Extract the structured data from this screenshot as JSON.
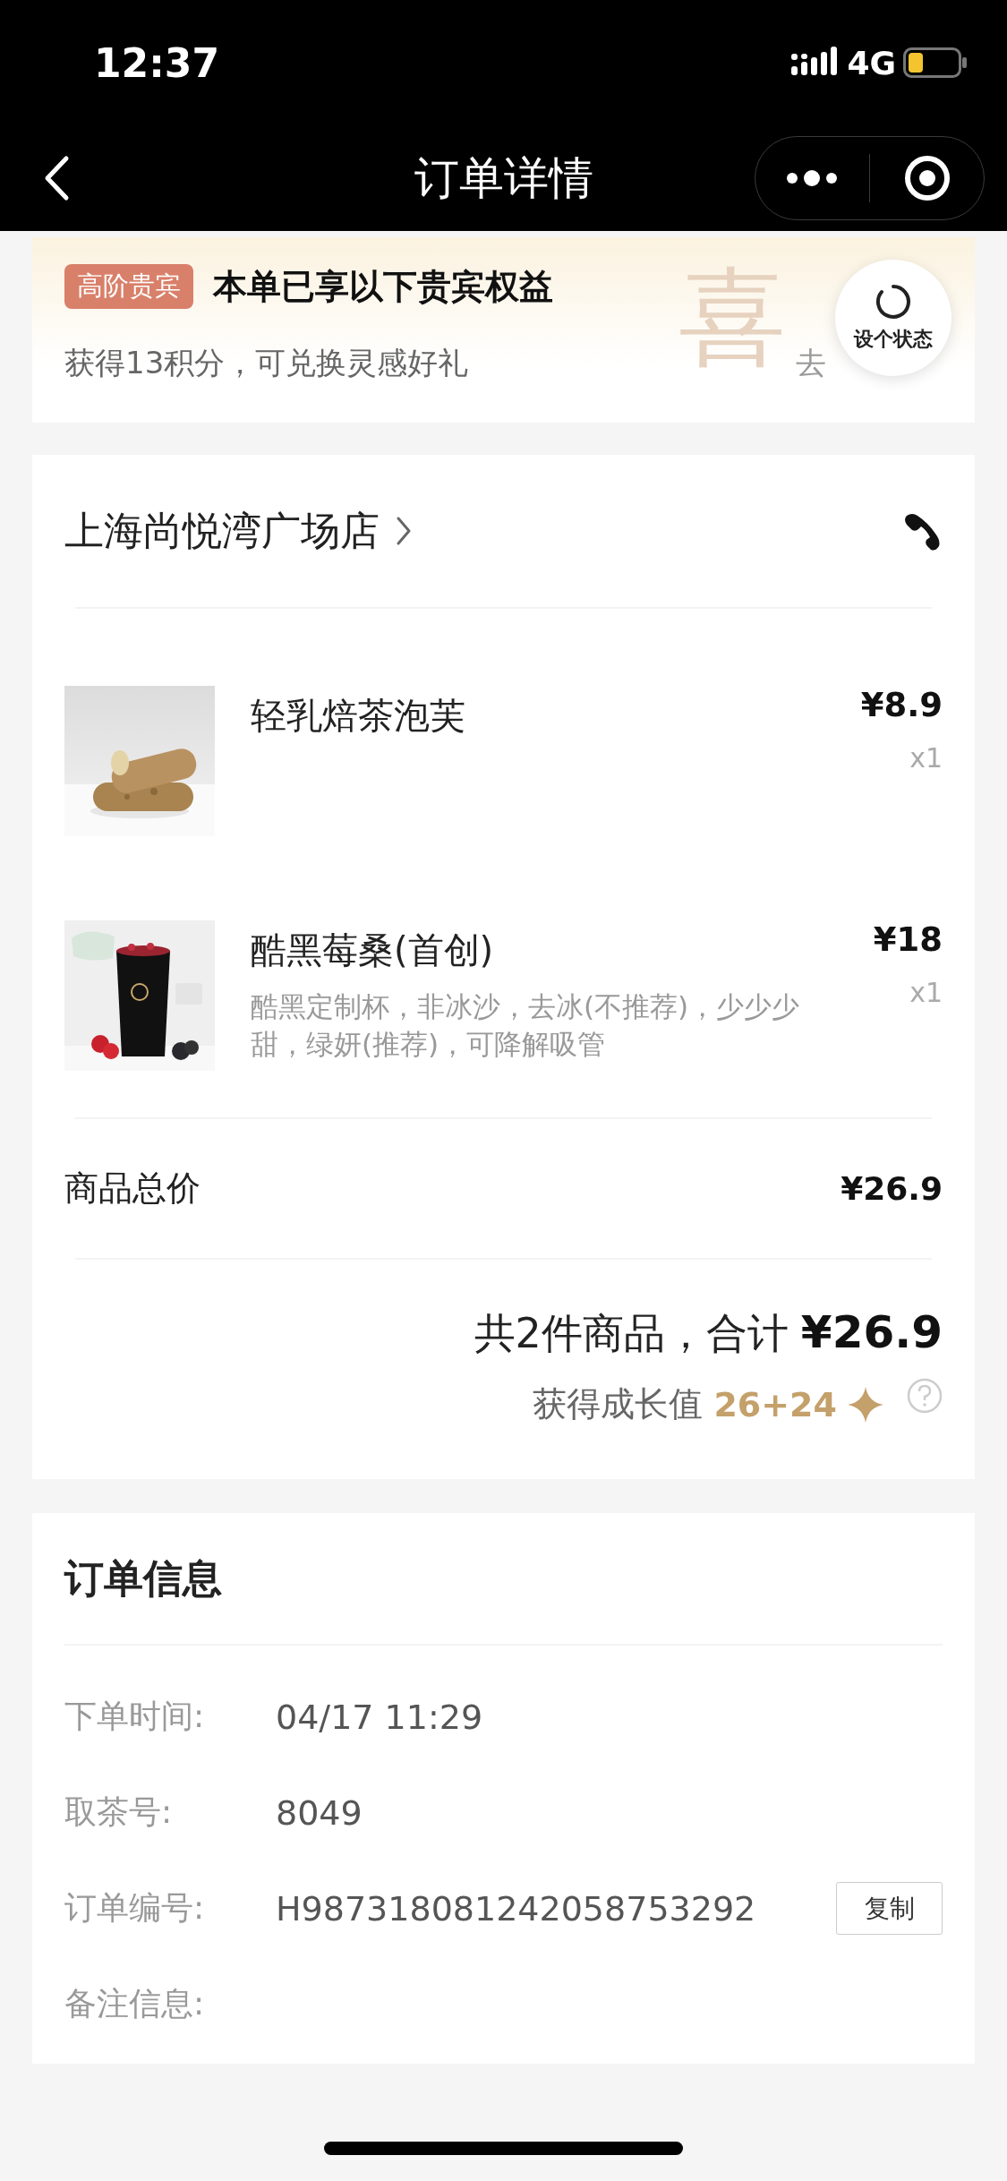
{
  "status_bar": {
    "time": "12:37",
    "network": "4G"
  },
  "nav": {
    "title": "订单详情"
  },
  "vip_banner": {
    "badge": "高阶贵宾",
    "title": "本单已享以下贵宾权益",
    "subtitle": "获得13积分，可兑换灵感好礼",
    "decor_char": "喜",
    "link": "去",
    "floating_button": "设个状态"
  },
  "store": {
    "name": "上海尚悦湾广场店"
  },
  "items": [
    {
      "name": "轻乳焙茶泡芙",
      "price": "¥8.9",
      "quantity": "x1"
    },
    {
      "name": "酷黑莓桑(首创)",
      "price": "¥18",
      "quantity": "x1",
      "options": "酷黑定制杯，非冰沙，去冰(不推荐)，少少少甜，绿妍(推荐)，可降解吸管"
    }
  ],
  "summary": {
    "label": "商品总价",
    "value": "¥26.9"
  },
  "total": {
    "text": "共2件商品，合计",
    "amount": "¥26.9"
  },
  "growth": {
    "label": "获得成长值",
    "value": "26+24"
  },
  "order_info": {
    "title": "订单信息",
    "rows": [
      {
        "label": "下单时间:",
        "value": "04/17 11:29"
      },
      {
        "label": "取茶号:",
        "value": "8049"
      },
      {
        "label": "订单编号:",
        "value": "H987318081242058753292",
        "button": "复制"
      },
      {
        "label": "备注信息:"
      }
    ]
  }
}
